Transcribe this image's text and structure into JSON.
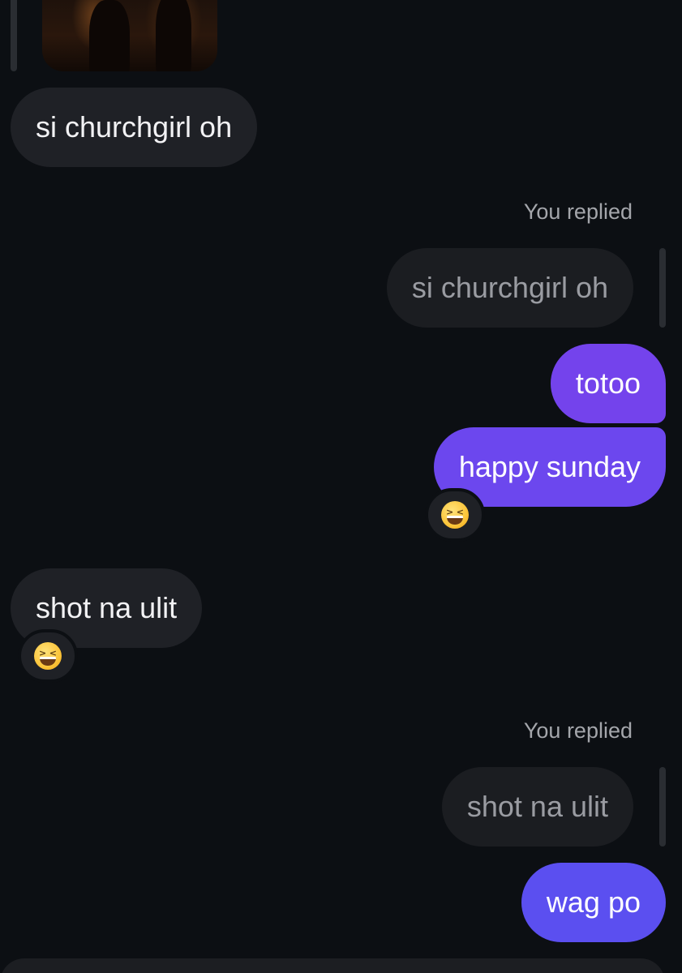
{
  "colors": {
    "background": "#0c0f13",
    "incoming_bubble": "#1f2126",
    "quoted_bubble": "#1b1d21",
    "outgoing_top": "#7443ec",
    "outgoing_bottom": "#5b4ff0"
  },
  "messages": {
    "m1": {
      "text": "si churchgirl oh"
    },
    "reply1": {
      "label": "You replied",
      "quoted": "si churchgirl oh"
    },
    "m2": {
      "text": "totoo"
    },
    "m3": {
      "text": "happy sunday",
      "reaction": "laughing-squinting-face-emoji"
    },
    "m4": {
      "text": "shot na ulit",
      "reaction": "laughing-squinting-face-emoji"
    },
    "reply2": {
      "label": "You replied",
      "quoted": "shot na ulit"
    },
    "m5": {
      "text": "wag po"
    }
  },
  "icons": {
    "reaction_emoji": "laughing-squinting-face-emoji"
  }
}
